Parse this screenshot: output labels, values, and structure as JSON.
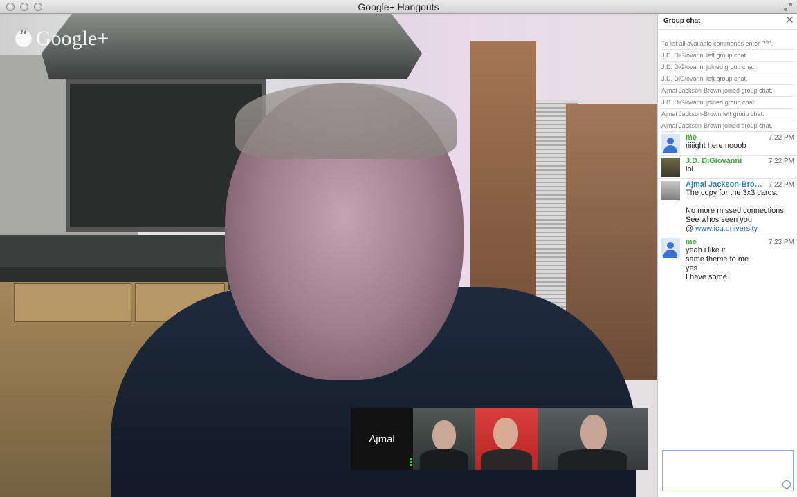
{
  "window": {
    "title": "Google+ Hangouts"
  },
  "video": {
    "brand": "Google+",
    "participants": [
      {
        "label": "Ajmal"
      }
    ]
  },
  "chat": {
    "title": "Group chat",
    "close_symbol": "✕",
    "system_messages": [
      "To list all available commands enter \"/?\".",
      "J.D. DiGiovanni left group chat.",
      "J.D. DiGiovanni joined group chat.",
      "J.D. DiGiovanni left group chat.",
      "Ajmal Jackson-Brown joined group chat.",
      "J.D. DiGiovanni joined group chat.",
      "Ajmal Jackson-Brown left group chat.",
      "Ajmal Jackson-Brown joined group chat."
    ],
    "messages": [
      {
        "sender": "me",
        "time": "7:22 PM",
        "lines": [
          "riiiight here nooob"
        ]
      },
      {
        "sender": "J.D. DiGiovanni",
        "time": "7:22 PM",
        "lines": [
          "lol"
        ]
      },
      {
        "sender": "Ajmal Jackson-Bro…",
        "time": "7:22 PM",
        "lines": [
          "The copy for the 3x3 cards:",
          "",
          "No more missed connections",
          "See whos seen you"
        ],
        "link_prefix": "@ ",
        "link_text": "www.icu.university"
      },
      {
        "sender": "me",
        "time": "7:23 PM",
        "lines": [
          "yeah i like it",
          "same theme to me",
          "yes",
          "I have some"
        ]
      }
    ],
    "input_value": ""
  },
  "icons": [
    "resize-icon",
    "close-icon",
    "smiley-icon",
    "google-plus-icon",
    "avatar-icon",
    "mic-level-icon"
  ]
}
